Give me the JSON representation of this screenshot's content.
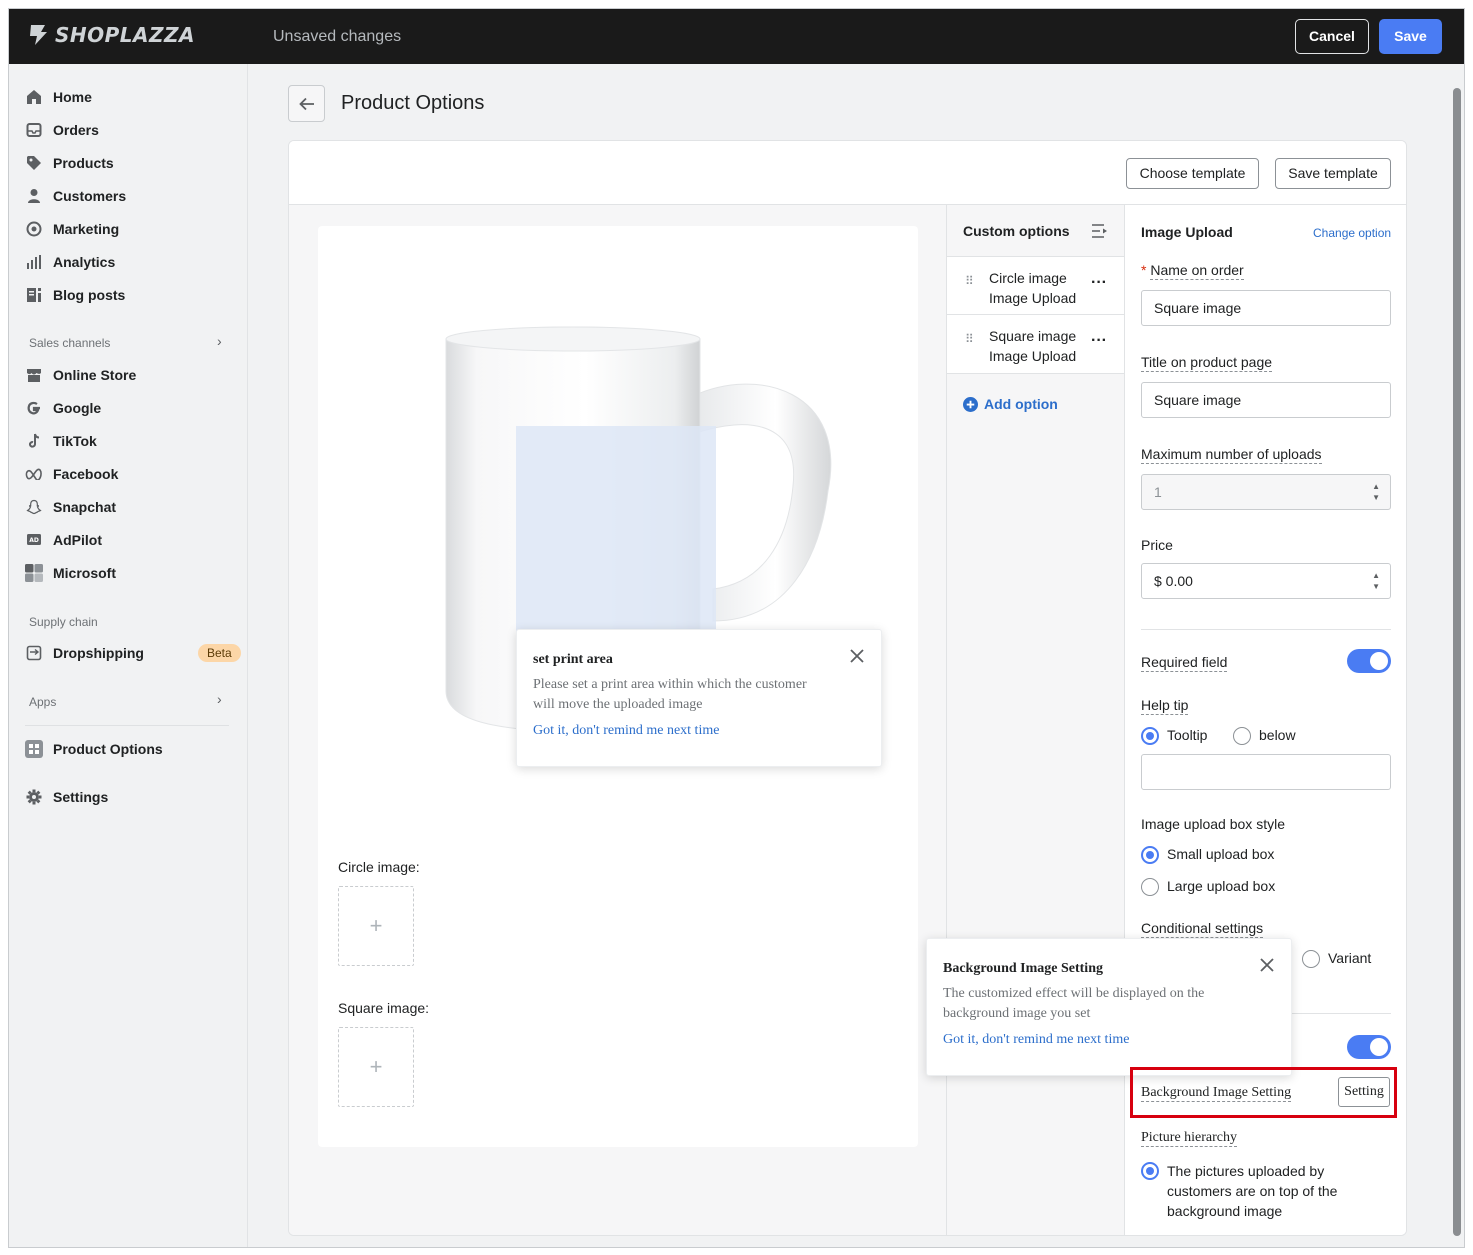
{
  "app": {
    "brand": "SHOPLAZZA",
    "status": "Unsaved changes"
  },
  "topbar": {
    "cancel_label": "Cancel",
    "save_label": "Save"
  },
  "sidebar": {
    "main_items": [
      {
        "label": "Home",
        "icon": "home-icon"
      },
      {
        "label": "Orders",
        "icon": "inbox-icon"
      },
      {
        "label": "Products",
        "icon": "tag-icon"
      },
      {
        "label": "Customers",
        "icon": "person-icon"
      },
      {
        "label": "Marketing",
        "icon": "target-icon"
      },
      {
        "label": "Analytics",
        "icon": "bar-chart-icon"
      },
      {
        "label": "Blog posts",
        "icon": "blog-icon"
      }
    ],
    "sales_channels_label": "Sales channels",
    "channels": [
      {
        "label": "Online Store",
        "icon": "store-icon"
      },
      {
        "label": "Google",
        "icon": "google-icon"
      },
      {
        "label": "TikTok",
        "icon": "tiktok-icon"
      },
      {
        "label": "Facebook",
        "icon": "meta-icon"
      },
      {
        "label": "Snapchat",
        "icon": "snapchat-icon"
      },
      {
        "label": "AdPilot",
        "icon": "adpilot-icon"
      },
      {
        "label": "Microsoft",
        "icon": "microsoft-icon"
      }
    ],
    "supply_chain_label": "Supply chain",
    "dropshipping_label": "Dropshipping",
    "dropshipping_badge": "Beta",
    "apps_label": "Apps",
    "product_options_label": "Product Options",
    "settings_label": "Settings"
  },
  "page": {
    "title": "Product Options"
  },
  "toolbar": {
    "choose_template": "Choose template",
    "save_template": "Save template"
  },
  "preview": {
    "circle_label": "Circle image:",
    "square_label": "Square image:",
    "upload_plus": "+",
    "print_area_popover": {
      "title": "set print area",
      "text_line1": "Please set a print area within which the customer",
      "text_line2": "will move the uploaded image",
      "link": "Got it, don't remind me next time"
    }
  },
  "custom_options": {
    "heading": "Custom options",
    "items": [
      {
        "name": "Circle image",
        "type": "Image Upload"
      },
      {
        "name": "Square image",
        "type": "Image Upload"
      }
    ],
    "add_label": "Add option"
  },
  "settings": {
    "section_title": "Image Upload",
    "change_option": "Change option",
    "name_on_order_label": "Name on order",
    "required_mark": "*",
    "name_on_order_value": "Square image",
    "title_label": "Title on product page",
    "title_value": "Square image",
    "max_uploads_label": "Maximum number of uploads",
    "max_uploads_value": "1",
    "price_label": "Price",
    "price_value": "$ 0.00",
    "required_field_label": "Required field",
    "required_field_on": true,
    "help_tip_label": "Help tip",
    "help_tip_options": [
      "Tooltip",
      "below"
    ],
    "help_tip_selected": "Tooltip",
    "box_style_label": "Image upload box style",
    "box_style_options": [
      "Small upload box",
      "Large upload box"
    ],
    "box_style_selected": "Small upload box",
    "conditional_label": "Conditional settings",
    "conditional_variant": "Variant",
    "second_toggle_on": true,
    "bg_setting_label": "Background Image Setting",
    "bg_setting_button": "Setting",
    "hierarchy_label": "Picture hierarchy",
    "hierarchy_line1": "The pictures uploaded by",
    "hierarchy_line2": "customers are on top of the",
    "hierarchy_line3": "background image"
  },
  "bg_popover": {
    "title": "Background Image Setting",
    "text_line1": "The customized effect will be displayed on the",
    "text_line2": "background image you set",
    "link": "Got it, don't remind me next time"
  },
  "colors": {
    "accent": "#4a7cf3",
    "link": "#2c6ecb",
    "highlight": "#d7000f"
  }
}
